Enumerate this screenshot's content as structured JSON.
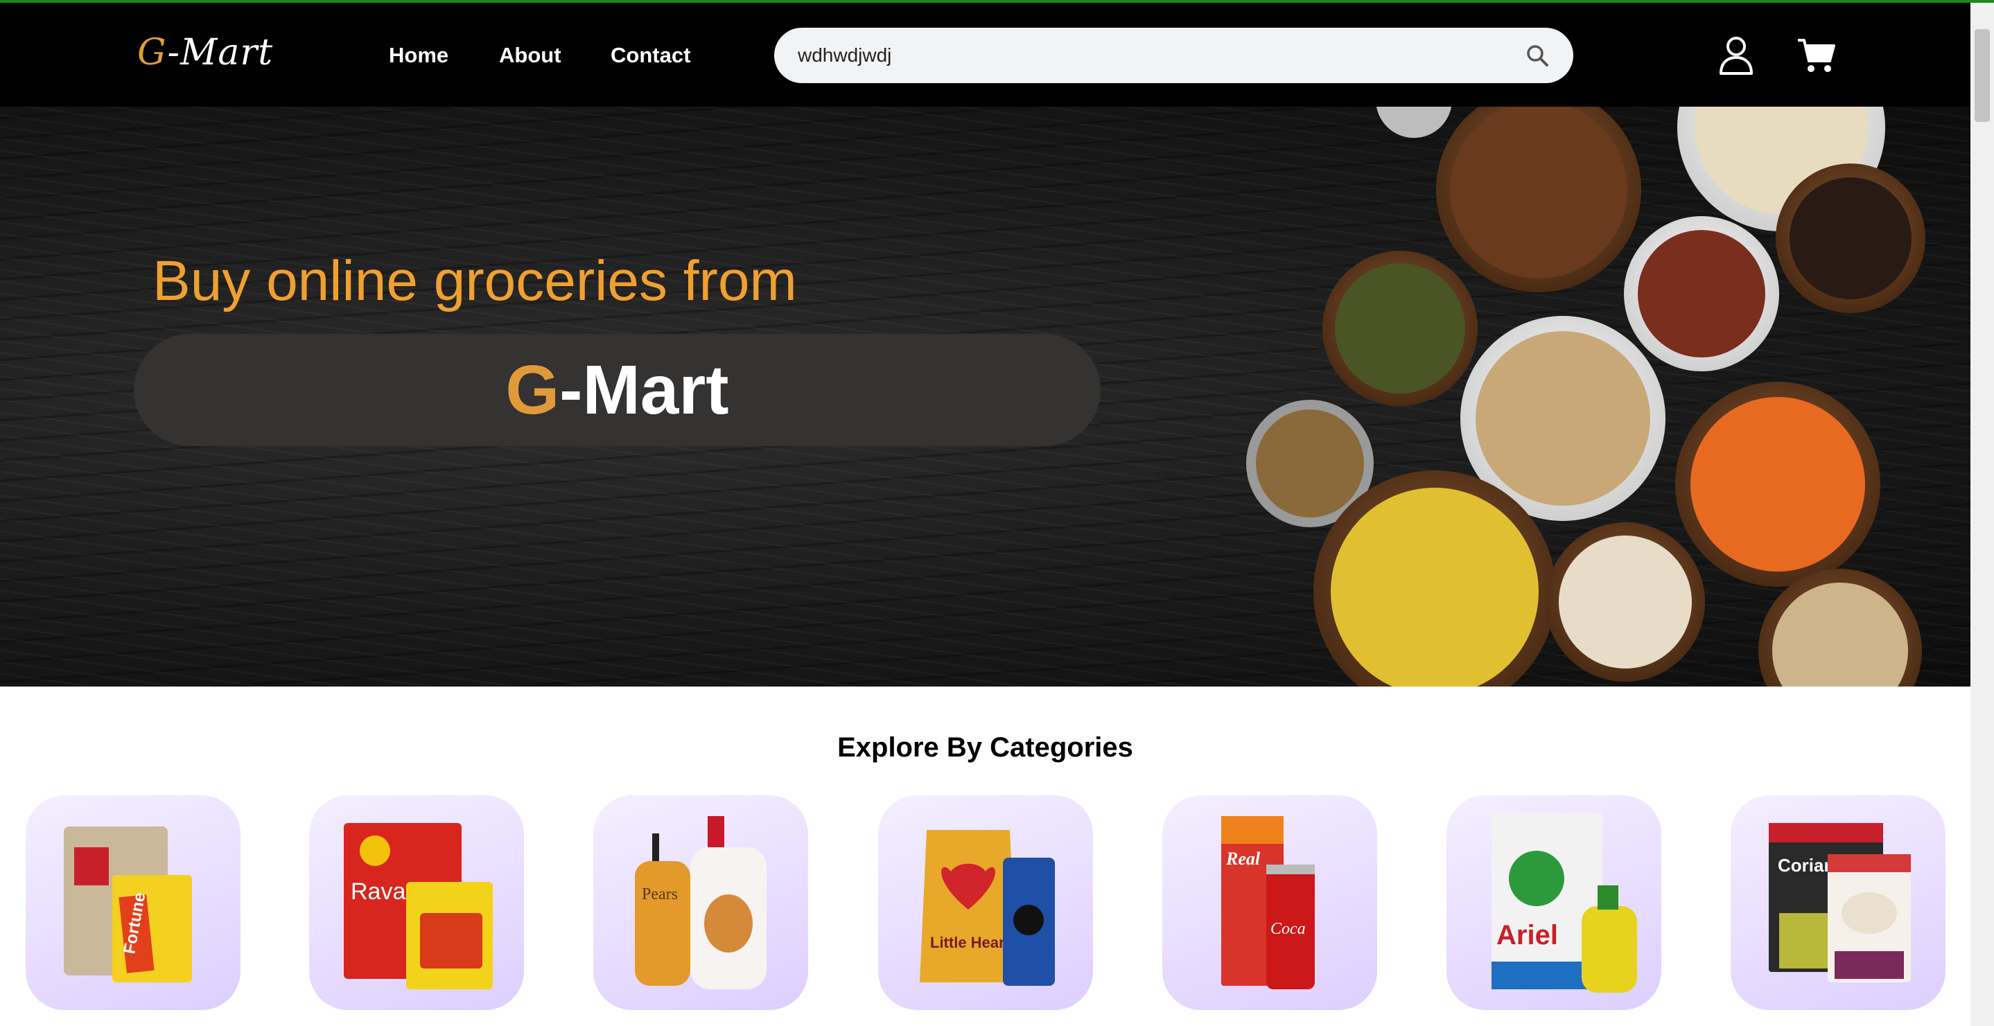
{
  "brand": {
    "logo_text_g": "G",
    "logo_text_rest": "-Mart",
    "accent_color": "#e0a030"
  },
  "nav": {
    "home": "Home",
    "about": "About",
    "contact": "Contact"
  },
  "search": {
    "value": "wdhwdjwdj",
    "icon": "search-icon"
  },
  "header_icons": {
    "user": "user-icon",
    "cart": "cart-icon"
  },
  "hero": {
    "tagline": "Buy online groceries from",
    "brand_g": "G",
    "brand_rest": "-Mart"
  },
  "categories": {
    "title": "Explore By Categories",
    "items": [
      {
        "icon": "atta-oil-icon",
        "image_text": "Fortune"
      },
      {
        "icon": "instant-food-icon",
        "image_text": "Rava Idli"
      },
      {
        "icon": "personal-care-icon",
        "image_text": "Pears"
      },
      {
        "icon": "snacks-icon",
        "image_text": "Little Hearts"
      },
      {
        "icon": "beverages-icon",
        "image_text": "Real"
      },
      {
        "icon": "cleaning-icon",
        "image_text": "Ariel"
      },
      {
        "icon": "spices-icon",
        "image_text": "Coriander"
      }
    ]
  }
}
